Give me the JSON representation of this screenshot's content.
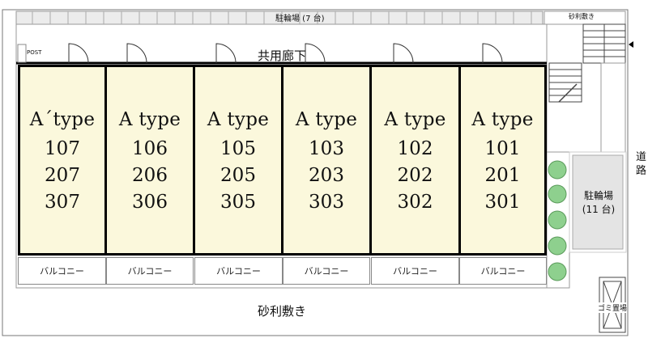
{
  "labels": {
    "corridor": "共用廊下",
    "gravel_bottom": "砂利敷き",
    "gravel_top": "砂利敷き",
    "bike_parking_top": "駐輪場 (7 台)",
    "bike_parking_right_name": "駐輪場",
    "bike_parking_right_count": "(11 台)",
    "road": "道路",
    "post": "POST",
    "garbage": "ゴミ置場"
  },
  "units": [
    {
      "type": "A´type",
      "rooms": [
        "107",
        "207",
        "307"
      ],
      "balcony": "バルコニー"
    },
    {
      "type": "A type",
      "rooms": [
        "106",
        "206",
        "306"
      ],
      "balcony": "バルコニー"
    },
    {
      "type": "A type",
      "rooms": [
        "105",
        "205",
        "305"
      ],
      "balcony": "バルコニー"
    },
    {
      "type": "A type",
      "rooms": [
        "103",
        "203",
        "303"
      ],
      "balcony": "バルコニー"
    },
    {
      "type": "A type",
      "rooms": [
        "102",
        "202",
        "302"
      ],
      "balcony": "バルコニー"
    },
    {
      "type": "A type",
      "rooms": [
        "101",
        "201",
        "301"
      ],
      "balcony": "バルコニー"
    }
  ],
  "colors": {
    "unit_fill": "#fbf8dc",
    "bike_fill": "#e4e4e4",
    "shrub_fill": "#8ed08e"
  }
}
